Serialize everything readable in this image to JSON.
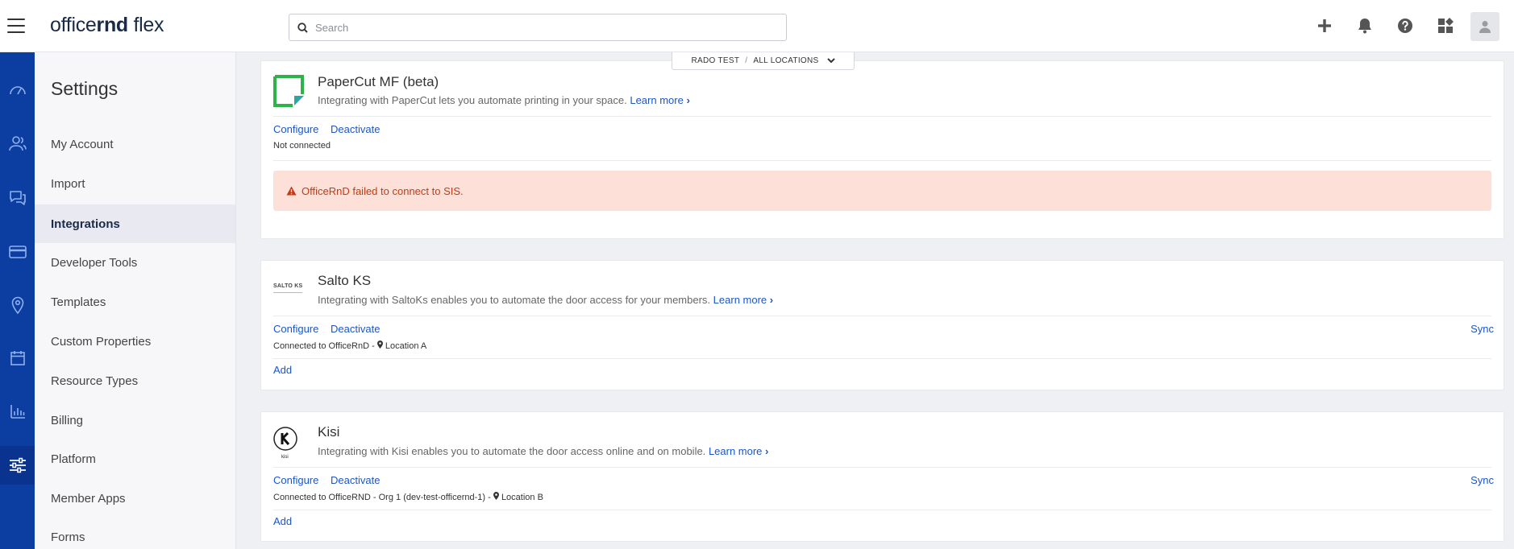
{
  "brand": {
    "part1": "office",
    "part2": "rnd",
    "part3": " flex"
  },
  "search": {
    "placeholder": "Search"
  },
  "top_icons": [
    "plus-icon",
    "bell-icon",
    "help-icon",
    "apps-icon",
    "user-icon"
  ],
  "location_switcher": {
    "account": "RADO TEST",
    "separator": "/",
    "location": "ALL LOCATIONS"
  },
  "rail": [
    "dashboard-icon",
    "members-icon",
    "chat-icon",
    "billing-card-icon",
    "location-pin-icon",
    "calendar-icon",
    "reports-icon",
    "settings-sliders-icon"
  ],
  "sidebar": {
    "title": "Settings",
    "items": [
      {
        "label": "My Account"
      },
      {
        "label": "Import"
      },
      {
        "label": "Integrations"
      },
      {
        "label": "Developer Tools"
      },
      {
        "label": "Templates"
      },
      {
        "label": "Custom Properties"
      },
      {
        "label": "Resource Types"
      },
      {
        "label": "Billing"
      },
      {
        "label": "Platform"
      },
      {
        "label": "Member Apps"
      },
      {
        "label": "Forms"
      }
    ],
    "active": "Integrations"
  },
  "integrations": [
    {
      "title": "PaperCut MF (beta)",
      "desc": "Integrating with PaperCut lets you automate printing in your space.",
      "learn_more": "Learn more",
      "configure": "Configure",
      "deactivate": "Deactivate",
      "status": "Not connected",
      "alert": "OfficeRnD failed to connect to SIS."
    },
    {
      "title": "Salto KS",
      "desc": "Integrating with SaltoKs enables you to automate the door access for your members.",
      "learn_more": "Learn more",
      "configure": "Configure",
      "deactivate": "Deactivate",
      "sync": "Sync",
      "status_prefix": "Connected to OfficeRnD -",
      "location": "Location A",
      "add": "Add",
      "logo_text": "SALTO KS"
    },
    {
      "title": "Kisi",
      "desc": "Integrating with Kisi enables you to automate the door access online and on mobile.",
      "learn_more": "Learn more",
      "configure": "Configure",
      "deactivate": "Deactivate",
      "sync": "Sync",
      "status_prefix": "Connected to OfficeRND - Org 1 (dev-test-officernd-1) -",
      "location": "Location B",
      "add": "Add",
      "logo_text": "kisi"
    }
  ],
  "colors": {
    "rail": "#0c3ea1",
    "link": "#1a56c8",
    "alert_bg": "#fde0d8",
    "alert_text": "#c23b14",
    "papercut_green": "#2db34a"
  }
}
